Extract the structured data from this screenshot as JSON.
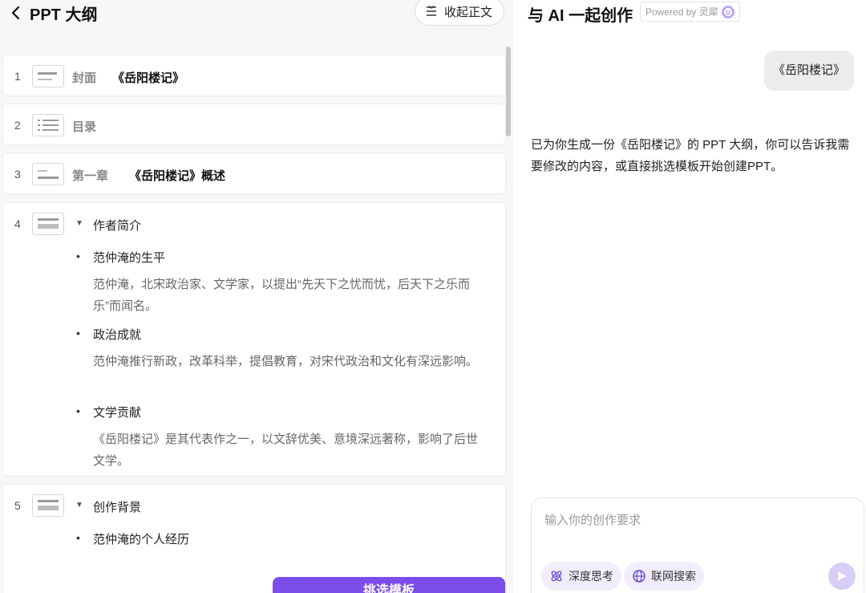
{
  "left_header": {
    "title": "PPT 大纲",
    "collapse_label": "收起正文"
  },
  "outline": {
    "cover": {
      "num": "1",
      "kind": "封面",
      "title": "《岳阳楼记》"
    },
    "toc": {
      "num": "2",
      "kind": "目录"
    },
    "chapter": {
      "num": "3",
      "kind": "第一章",
      "title": "《岳阳楼记》概述"
    },
    "section4": {
      "num": "4",
      "title": "作者简介",
      "items": [
        {
          "title": "范仲淹的生平",
          "desc": "范仲淹，北宋政治家、文学家，以提出“先天下之忧而忧，后天下之乐而乐”而闻名。"
        },
        {
          "title": "政治成就",
          "desc": "范仲淹推行新政，改革科举，提倡教育，对宋代政治和文化有深远影响。"
        },
        {
          "title": "文学贡献",
          "desc": "《岳阳楼记》是其代表作之一，以文辞优美、意境深远著称，影响了后世文学。"
        }
      ]
    },
    "section5": {
      "num": "5",
      "title": "创作背景",
      "items": [
        {
          "title": "范仲淹的个人经历"
        }
      ]
    }
  },
  "choose_template_label": "挑选模板",
  "chat": {
    "title": "与 AI 一起创作",
    "powered": "Powered by 灵犀",
    "user_message": "《岳阳楼记》",
    "ai_message": "已为你生成一份《岳阳楼记》的 PPT 大纲，你可以告诉我需要修改的内容，或直接挑选模板开始创建PPT。",
    "input_placeholder": "输入你的创作要求",
    "chips": {
      "deep_think": "深度思考",
      "web_search": "联网搜索"
    }
  }
}
